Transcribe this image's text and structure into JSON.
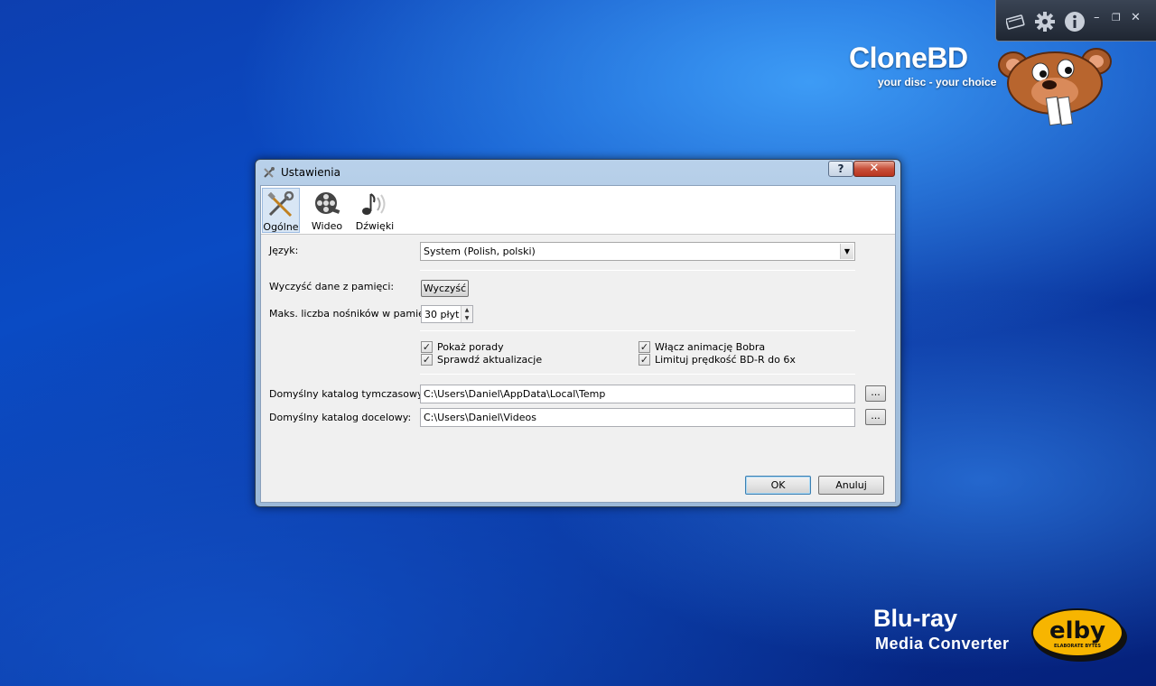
{
  "app": {
    "logo_title": "CloneBD",
    "logo_subtitle": "your disc - your choice",
    "product_line1": "Blu-ray",
    "product_line2": "Media Converter",
    "toolbar_icons": [
      "disc-icon",
      "gear-icon",
      "info-icon"
    ],
    "window_controls": [
      "minimize",
      "restore",
      "close"
    ]
  },
  "dialog": {
    "title": "Ustawienia",
    "help_label": "?",
    "close_label": "✕",
    "tabs": [
      {
        "label": "Ogólne",
        "icon": "tools-icon",
        "selected": true
      },
      {
        "label": "Wideo",
        "icon": "film-reel-icon",
        "selected": false
      },
      {
        "label": "Dźwięki",
        "icon": "music-note-icon",
        "selected": false
      }
    ],
    "language": {
      "label": "Język:",
      "value": "System (Polish, polski)"
    },
    "clear_cache": {
      "label": "Wyczyść dane z pamięci:",
      "button": "Wyczyść"
    },
    "max_media": {
      "label": "Maks. liczba nośników w pamięci:",
      "value": "30 płyt"
    },
    "checkboxes": [
      {
        "label": "Pokaż porady",
        "checked": true
      },
      {
        "label": "Sprawdź aktualizacje",
        "checked": true
      },
      {
        "label": "Włącz animację Bobra",
        "checked": true
      },
      {
        "label": "Limituj prędkość BD-R do 6x",
        "checked": true
      }
    ],
    "temp_dir": {
      "label": "Domyślny katalog tymczasowy:",
      "value": "C:\\Users\\Daniel\\AppData\\Local\\Temp",
      "browse": "..."
    },
    "target_dir": {
      "label": "Domyślny katalog docelowy:",
      "value": "C:\\Users\\Daniel\\Videos",
      "browse": "..."
    },
    "ok_label": "OK",
    "cancel_label": "Anuluj"
  },
  "colors": {
    "accent_blue": "#0b3aa8",
    "close_red": "#c8503a",
    "elby_yellow": "#f7b500"
  },
  "elby": {
    "logo_text": "elby",
    "logo_tagline": "ELABORATE BYTES"
  }
}
